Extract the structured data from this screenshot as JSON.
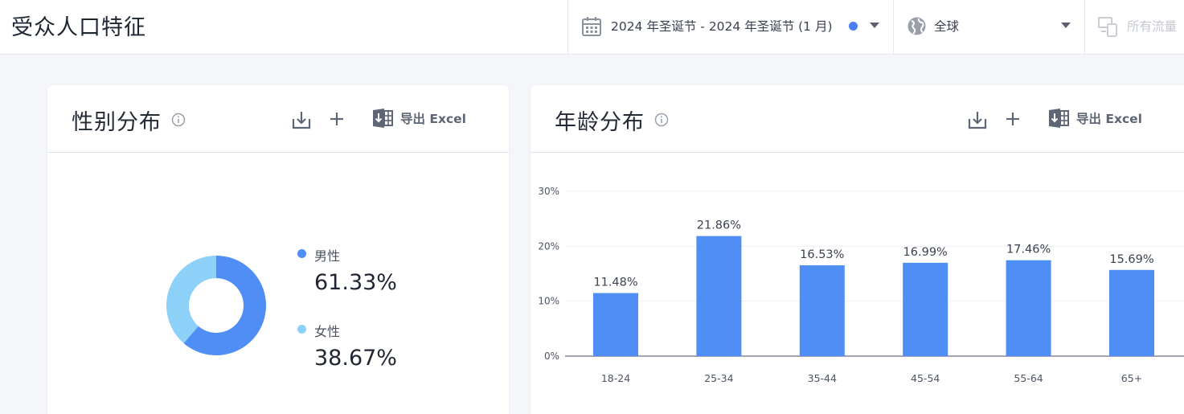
{
  "header": {
    "title": "受众人口特征",
    "date_range": "2024 年圣诞节 - 2024 年圣诞节 (1 月)",
    "region": "全球",
    "traffic": "所有流量"
  },
  "colors": {
    "accent": "#4a7ef0",
    "bar": "#4f8ef5",
    "female": "#8dd0f8"
  },
  "icons": {
    "date": "calendar-icon",
    "region": "globe-icon",
    "traffic": "traffic-type-icon",
    "download": "download-icon",
    "add": "plus-icon",
    "excel": "excel-icon",
    "info": "info-icon"
  },
  "gender_card": {
    "title": "性别分布",
    "export_label": "导出 Excel",
    "legend": [
      {
        "label": "男性",
        "value": "61.33%"
      },
      {
        "label": "女性",
        "value": "38.67%"
      }
    ]
  },
  "age_card": {
    "title": "年龄分布",
    "export_label": "导出 Excel"
  },
  "chart_data": [
    {
      "type": "pie",
      "donut": true,
      "categories": [
        "男性",
        "女性"
      ],
      "values": [
        61.33,
        38.67
      ],
      "colors": [
        "#4f8ef5",
        "#8dd0f8"
      ]
    },
    {
      "type": "bar",
      "categories": [
        "18-24",
        "25-34",
        "35-44",
        "45-54",
        "55-64",
        "65+"
      ],
      "values": [
        11.48,
        21.86,
        16.53,
        16.99,
        17.46,
        15.69
      ],
      "data_labels": [
        "11.48%",
        "21.86%",
        "16.53%",
        "16.99%",
        "17.46%",
        "15.69%"
      ],
      "ylim": [
        0,
        30
      ],
      "yticks": [
        "0%",
        "10%",
        "20%",
        "30%"
      ],
      "grid": true
    }
  ]
}
